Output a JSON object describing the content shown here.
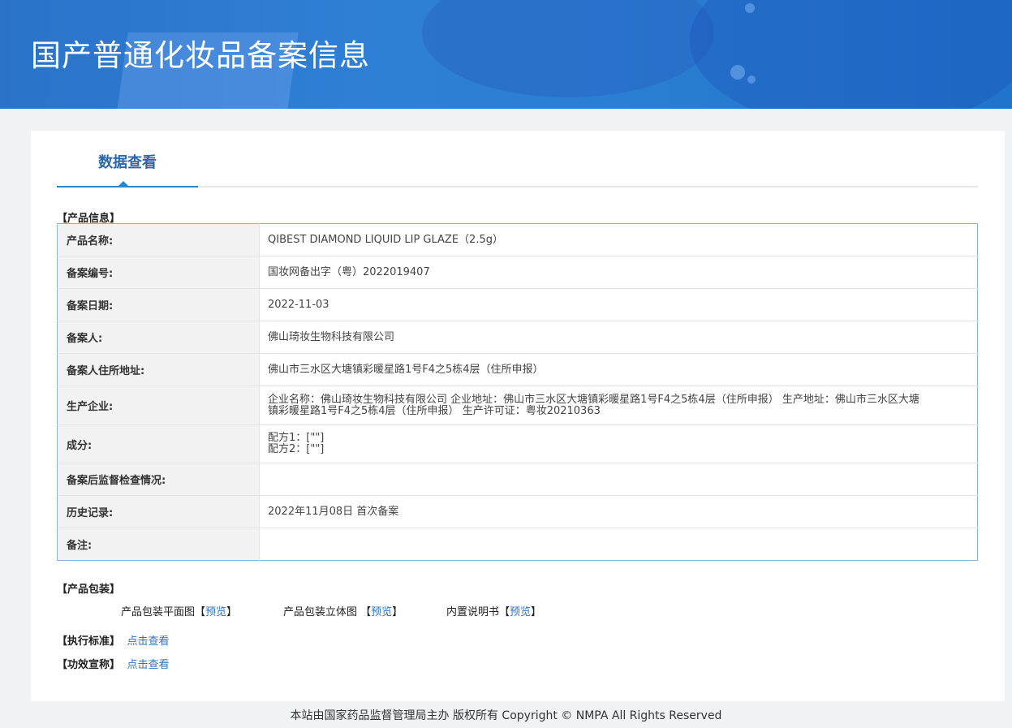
{
  "header": {
    "title": "国产普通化妆品备案信息"
  },
  "tab": {
    "label": "数据查看"
  },
  "sections": {
    "product_info": "【产品信息】",
    "product_package": "【产品包装】",
    "standard": "【执行标准】",
    "efficacy": "【功效宣称】"
  },
  "product_info": [
    {
      "label": "产品名称:",
      "value": "QIBEST DIAMOND LIQUID LIP GLAZE（2.5g）"
    },
    {
      "label": "备案编号:",
      "value": "国妆网备出字（粤）2022019407"
    },
    {
      "label": "备案日期:",
      "value": "2022-11-03"
    },
    {
      "label": "备案人:",
      "value": "佛山琦妆生物科技有限公司"
    },
    {
      "label": "备案人住所地址:",
      "value": "佛山市三水区大塘镇彩暖星路1号F4之5栋4层（住所申报）"
    },
    {
      "label": "生产企业:",
      "value": "企业名称：佛山琦妆生物科技有限公司 企业地址：佛山市三水区大塘镇彩暖星路1号F4之5栋4层（住所申报） 生产地址：佛山市三水区大塘镇彩暖星路1号F4之5栋4层（住所申报） 生产许可证：粤妆20210363"
    },
    {
      "label": "成分:",
      "value_lines": [
        "配方1：[\"\"]",
        "配方2：[\"\"]"
      ]
    },
    {
      "label": "备案后监督检查情况:",
      "value": ""
    },
    {
      "label": "历史记录:",
      "value": "2022年11月08日 首次备案"
    },
    {
      "label": "备注:",
      "value": ""
    }
  ],
  "package": {
    "flat": {
      "label": "产品包装平面图",
      "link": "预览"
    },
    "solid": {
      "label": "产品包装立体图",
      "link": "预览"
    },
    "manual": {
      "label": "内置说明书",
      "link": "预览"
    }
  },
  "links": {
    "view": "点击查看"
  },
  "footer": {
    "text": "本站由国家药品监督管理局主办 版权所有 Copyright © NMPA All Rights Reserved"
  }
}
